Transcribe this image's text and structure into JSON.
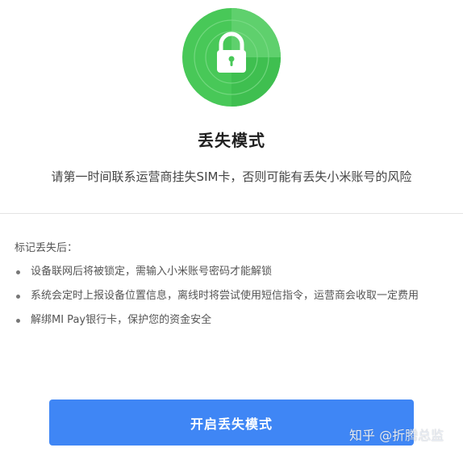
{
  "colors": {
    "green_light": "#6fd47a",
    "green_dark": "#3fc24f",
    "button_blue": "#3f86f5"
  },
  "hero": {
    "icon": "lock-icon",
    "title": "丢失模式",
    "subtitle": "请第一时间联系运营商挂失SIM卡，否则可能有丢失小米账号的风险"
  },
  "info": {
    "header": "标记丢失后：",
    "bullets": [
      "设备联网后将被锁定，需输入小米账号密码才能解锁",
      "系统会定时上报设备位置信息，离线时将尝试使用短信指令，运营商会收取一定费用",
      "解绑MI Pay银行卡，保护您的资金安全"
    ]
  },
  "action": {
    "label": "开启丢失模式"
  },
  "watermark": {
    "text": "知乎 @折腾总监"
  }
}
